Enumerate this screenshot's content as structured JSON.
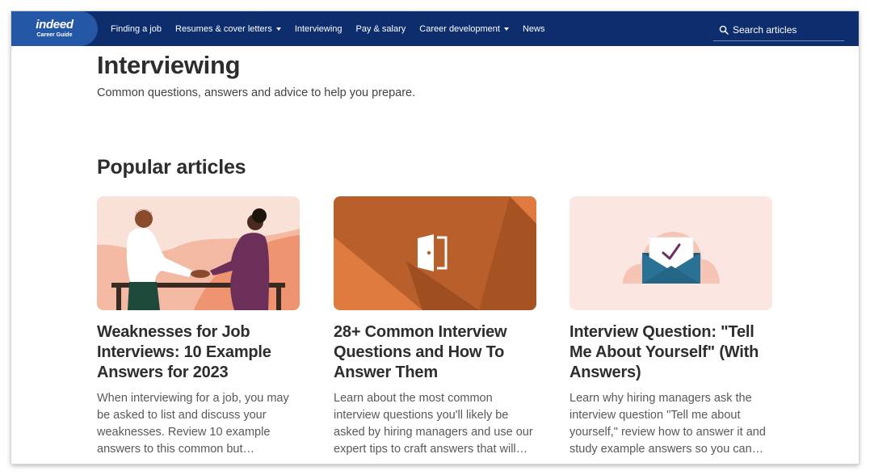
{
  "nav": {
    "logo_word": "indeed",
    "logo_sub": "Career Guide",
    "items": [
      {
        "label": "Finding a job",
        "has_caret": false
      },
      {
        "label": "Resumes & cover letters",
        "has_caret": true
      },
      {
        "label": "Interviewing",
        "has_caret": false
      },
      {
        "label": "Pay & salary",
        "has_caret": false
      },
      {
        "label": "Career development",
        "has_caret": true
      },
      {
        "label": "News",
        "has_caret": false
      }
    ],
    "search_placeholder": "Search articles"
  },
  "page": {
    "title": "Interviewing",
    "subtitle": "Common questions, answers and advice to help you prepare.",
    "section_title": "Popular articles"
  },
  "articles": [
    {
      "title": "Weaknesses for Job Interviews: 10 Example Answers for 2023",
      "description": "When interviewing for a job, you may be asked to list and discuss your weaknesses. Review 10 example answers to this common but…",
      "image": "handshake-illustration"
    },
    {
      "title": "28+ Common Interview Questions and How To Answer Them",
      "description": "Learn about the most common interview questions you'll likely be asked by hiring managers and use our expert tips to craft answers that will…",
      "image": "door-icon-illustration"
    },
    {
      "title": "Interview Question: \"Tell Me About Yourself\" (With Answers)",
      "description": "Learn why hiring managers ask the interview question \"Tell me about yourself,\" review how to answer it and study example answers so you can…",
      "image": "envelope-checkmark-illustration"
    }
  ],
  "colors": {
    "nav_bg": "#0d2d6c",
    "logo_bg": "#2557a7",
    "orange": "#b85f2b",
    "peach": "#f9e3dc"
  }
}
